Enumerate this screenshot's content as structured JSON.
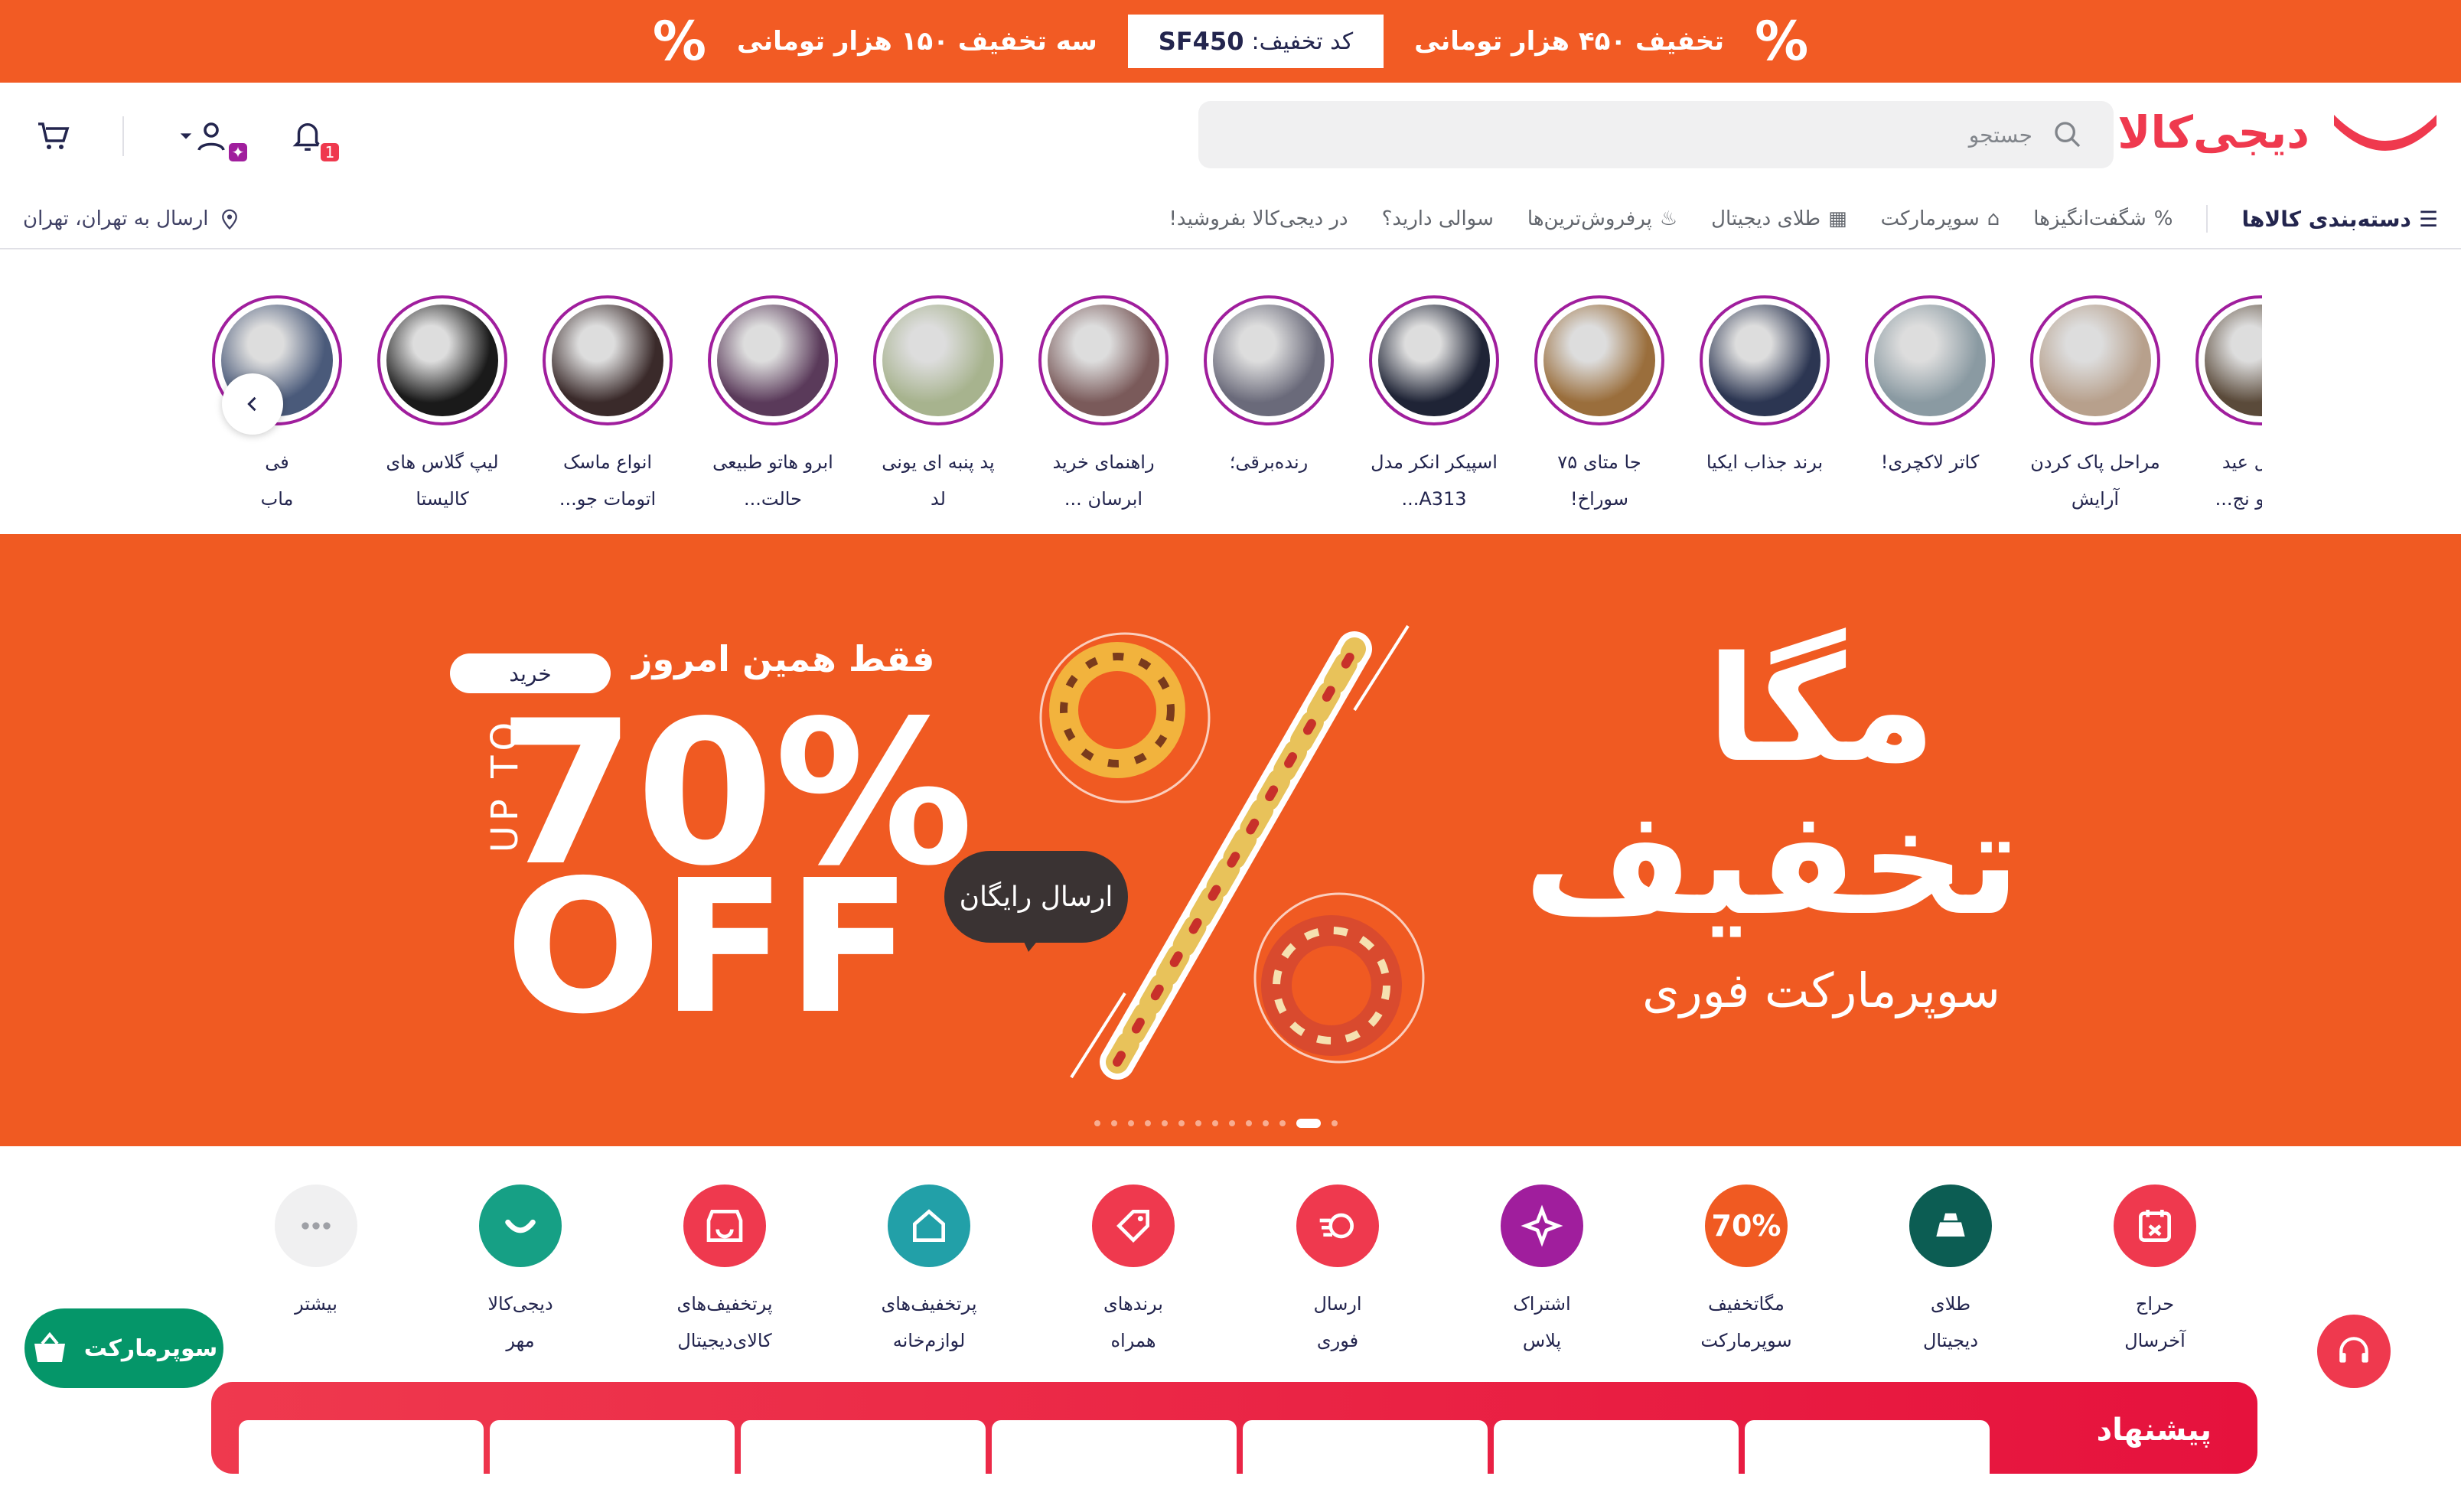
{
  "promo": {
    "left_text": "سه تخفیف ۱۵۰ هزار تومانی",
    "code_label": "کد تخفیف:",
    "code_value": "SF450",
    "right_text": "تخفیف ۴۵۰ هزار تومانی",
    "pct_symbol": "%"
  },
  "header": {
    "logo_text": "دیجی‌کالا",
    "search_placeholder": "جستجو",
    "notifications_count": "1"
  },
  "nav": {
    "categories": "دسته‌بندی کالاها",
    "items": [
      "شگفت‌انگیزها",
      "سوپرمارکت",
      "طلای دیجیتال",
      "پرفروش‌ترین‌ها",
      "سوالی دارید؟",
      "در دیجی‌کالا بفروشید!"
    ],
    "location": "ارسال به تهران، تهران"
  },
  "stories": [
    {
      "caption": "تا قبل عید\nپوستتو نج...",
      "color": "#5a4a3a"
    },
    {
      "caption": "مراحل پاک کردن\nآرایش",
      "color": "#b7a08c"
    },
    {
      "caption": "کاتر لاکچری!",
      "color": "#8a9aa2"
    },
    {
      "caption": "برند جذاب ایکیا",
      "color": "#2c3652"
    },
    {
      "caption": "جا متای ۷۵\nسوراخ!",
      "color": "#9a6e3c"
    },
    {
      "caption": "اسپیکر انکر مدل\nA313...",
      "color": "#1f2436"
    },
    {
      "caption": "رنده‌برقی؛",
      "color": "#6a6a7a"
    },
    {
      "caption": "راهنمای خرید\nابرسان ...",
      "color": "#7a5a5a"
    },
    {
      "caption": "پد پنبه ای یونی\nلد",
      "color": "#a7b38e"
    },
    {
      "caption": "ابرو هاتو طبیعی\nحالت...",
      "color": "#5a3a5a"
    },
    {
      "caption": "انواع ماسک\nاتومات جو...",
      "color": "#3a2a2a"
    },
    {
      "caption": "لیپ گلاس های\nکالیستا",
      "color": "#1a1a1a"
    },
    {
      "caption": "فی\nماب",
      "color": "#4a5a7a"
    }
  ],
  "banner": {
    "today_only": "فقط همین امروز",
    "buy": "خرید",
    "up_to": "UP TO",
    "pct": "70%",
    "off": "OFF",
    "free_shipping": "ارسال رایگان",
    "mega": "مگا",
    "discount": "تخفیف",
    "supermarket": "سوپرمارکت فوری",
    "slide_count": 14,
    "active_slide": 13
  },
  "quick_links": [
    {
      "caption": "حراج\nآخرسال",
      "color": "#ef394e",
      "icon": "calendar-icon"
    },
    {
      "caption": "طلای\nدیجیتال",
      "color": "#0c5d53",
      "icon": "gold-icon"
    },
    {
      "caption": "مگاتخفیف\nسوپرمارکت",
      "color": "#f05a22",
      "icon": "70%"
    },
    {
      "caption": "اشتراک\nپلاس",
      "color": "#a01e9d",
      "icon": "plus-icon"
    },
    {
      "caption": "ارسال\nفوری",
      "color": "#ef394e",
      "icon": "fast-icon"
    },
    {
      "caption": "برندهای\nهمراه",
      "color": "#ef394e",
      "icon": "tag-icon"
    },
    {
      "caption": "پرتخفیف‌های\nلوازم‌خانه",
      "color": "#22a0a8",
      "icon": "home-icon"
    },
    {
      "caption": "پرتخفیف‌های\nکالای‌دیجیتال",
      "color": "#ef394e",
      "icon": "shop-icon"
    },
    {
      "caption": "دیجی‌کالا\nمهر",
      "color": "#16a085",
      "icon": "smile-icon"
    },
    {
      "caption": "بیشتر",
      "color": "#f0f0f1",
      "icon": "more-icon"
    }
  ],
  "floating": {
    "supermarket_button": "سوپرمارکت"
  },
  "band": {
    "label": "پیشنهاد"
  }
}
